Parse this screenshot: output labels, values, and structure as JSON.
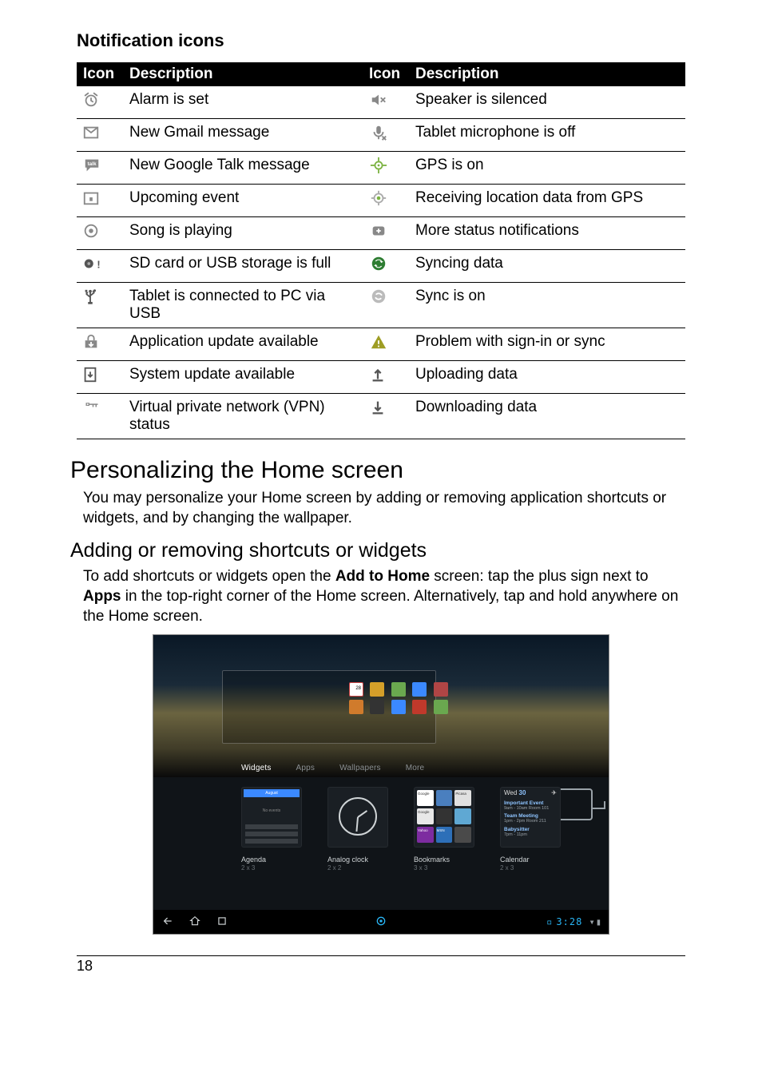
{
  "headings": {
    "notification_icons": "Notification icons",
    "personalizing": "Personalizing the Home screen",
    "adding_removing": "Adding or removing shortcuts or widgets"
  },
  "table": {
    "headers": {
      "icon": "Icon",
      "description": "Description"
    },
    "rows": [
      {
        "l": "Alarm is set",
        "r": "Speaker is silenced"
      },
      {
        "l": "New Gmail message",
        "r": "Tablet microphone is off"
      },
      {
        "l": "New Google Talk message",
        "r": "GPS is on"
      },
      {
        "l": "Upcoming event",
        "r": "Receiving location data from GPS"
      },
      {
        "l": "Song is playing",
        "r": "More status notifications"
      },
      {
        "l": "SD card or USB storage is full",
        "r": "Syncing data"
      },
      {
        "l": "Tablet is connected to PC via USB",
        "r": "Sync is on"
      },
      {
        "l": "Application update available",
        "r": "Problem with sign-in or sync"
      },
      {
        "l": "System update available",
        "r": "Uploading data"
      },
      {
        "l": "Virtual private network (VPN) status",
        "r": "Downloading data"
      }
    ]
  },
  "paragraphs": {
    "personalizing": "You may personalize your Home screen by adding or removing application shortcuts or widgets, and by changing the wallpaper.",
    "adding_pre": "To add shortcuts or widgets open the ",
    "adding_bold1": "Add to Home",
    "adding_mid": " screen: tap the plus sign next to ",
    "adding_bold2": "Apps",
    "adding_post": " in the top-right corner of the Home screen. Alternatively, tap and hold anywhere on the Home screen."
  },
  "screenshot": {
    "tabs": [
      "Widgets",
      "Apps",
      "Wallpapers",
      "More"
    ],
    "panel_date": "28",
    "widgets": [
      {
        "name": "Agenda",
        "size": "2 x 3",
        "hdr": "August",
        "sub": "No events"
      },
      {
        "name": "Analog clock",
        "size": "2 x 2"
      },
      {
        "name": "Bookmarks",
        "size": "3 x 3",
        "tiles": [
          {
            "label": "Google",
            "bg": "#ffffff"
          },
          {
            "label": "",
            "bg": "#4a7fbf"
          },
          {
            "label": "Picasa",
            "bg": "#e0e0e0"
          },
          {
            "label": "Google",
            "bg": "#e8e8e8"
          },
          {
            "label": "",
            "bg": "#333333"
          },
          {
            "label": "",
            "bg": "#5fa8d3"
          },
          {
            "label": "Yahoo",
            "bg": "#7d2ca0"
          },
          {
            "label": "MSN",
            "bg": "#2d6fb8"
          },
          {
            "label": "",
            "bg": "#4a4a4a"
          }
        ]
      },
      {
        "name": "Calendar",
        "size": "2 x 3",
        "day_label": "Wed",
        "day_num": "30",
        "events": [
          {
            "title": "Important Event",
            "detail": "9am - 10am\nRoom 101"
          },
          {
            "title": "Team Meeting",
            "detail": "1pm - 2pm\nRoom 211"
          },
          {
            "title": "Babysitter",
            "detail": "7pm - 11pm"
          }
        ]
      }
    ],
    "statusbar": {
      "time": "3:28"
    }
  },
  "page_number": "18"
}
